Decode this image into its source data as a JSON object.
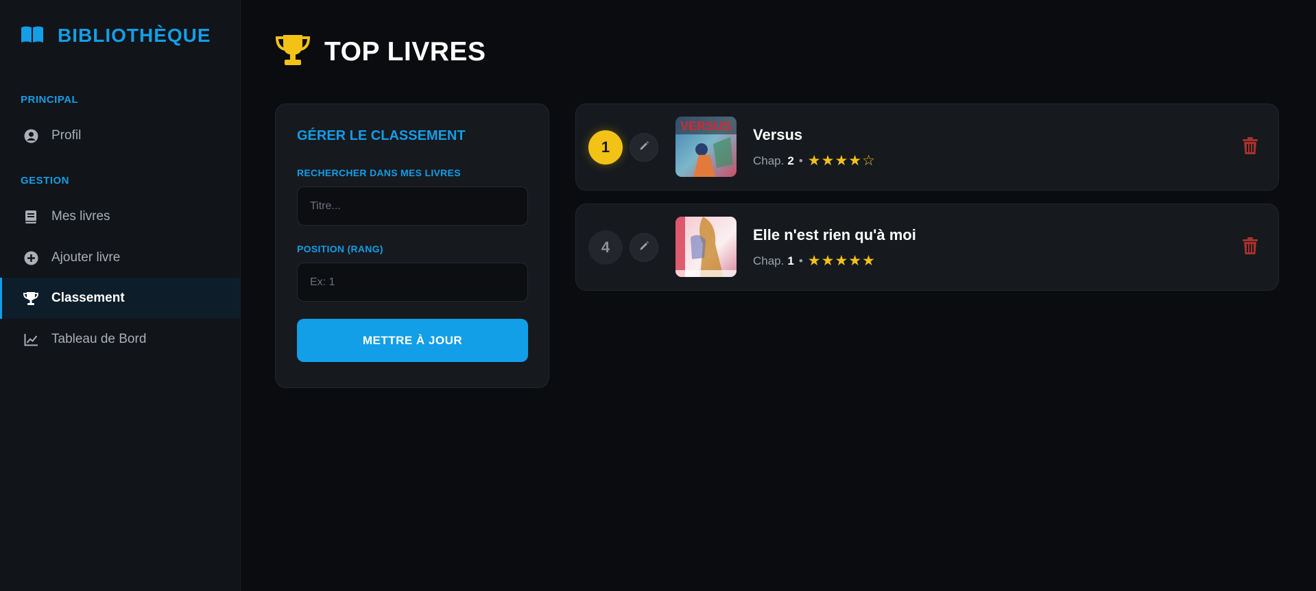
{
  "brand": {
    "name": "BIBLIOTHÈQUE"
  },
  "sidebar": {
    "sections": [
      {
        "label": "PRINCIPAL"
      },
      {
        "label": "GESTION"
      }
    ],
    "items": [
      {
        "label": "Profil",
        "icon": "user-circle-icon",
        "active": false
      },
      {
        "label": "Mes livres",
        "icon": "book-icon",
        "active": false
      },
      {
        "label": "Ajouter livre",
        "icon": "plus-circle-icon",
        "active": false
      },
      {
        "label": "Classement",
        "icon": "trophy-icon",
        "active": true
      },
      {
        "label": "Tableau de Bord",
        "icon": "line-chart-icon",
        "active": false
      }
    ]
  },
  "page": {
    "title": "TOP LIVRES"
  },
  "form": {
    "title": "GÉRER LE CLASSEMENT",
    "search_label": "RECHERCHER DANS MES LIVRES",
    "search_placeholder": "Titre...",
    "search_value": "",
    "position_label": "POSITION (RANG)",
    "position_placeholder": "Ex: 1",
    "position_value": "",
    "submit_label": "METTRE À JOUR"
  },
  "ranking": [
    {
      "rank": "1",
      "title": "Versus",
      "chapter_prefix": "Chap.",
      "chapter": "2",
      "separator": "•",
      "rating": 4,
      "stars": "★★★★☆",
      "cover_text": "VERSUS"
    },
    {
      "rank": "4",
      "title": "Elle n'est rien qu'à moi",
      "chapter_prefix": "Chap.",
      "chapter": "1",
      "separator": "•",
      "rating": 5,
      "stars": "★★★★★"
    }
  ],
  "colors": {
    "accent": "#139ee8",
    "gold": "#f2c216",
    "danger": "#a8322d",
    "background": "#0a0c0f",
    "sidebar": "#111418",
    "card": "#16191e"
  }
}
